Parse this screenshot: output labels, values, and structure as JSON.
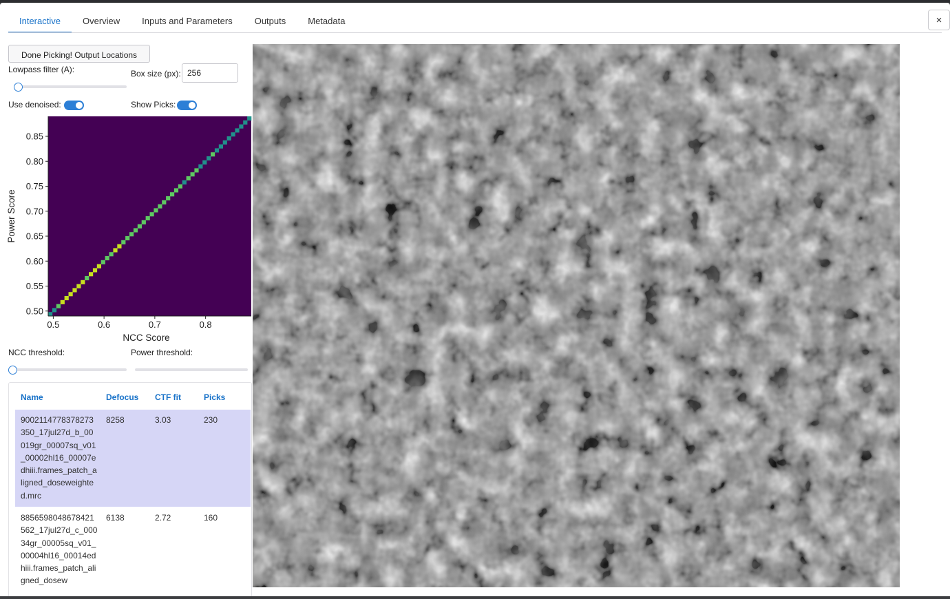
{
  "tabs": [
    {
      "label": "Interactive",
      "active": true
    },
    {
      "label": "Overview",
      "active": false
    },
    {
      "label": "Inputs and Parameters",
      "active": false
    },
    {
      "label": "Outputs",
      "active": false
    },
    {
      "label": "Metadata",
      "active": false
    }
  ],
  "close_label": "×",
  "controls": {
    "done_button": "Done Picking! Output Locations",
    "lowpass_label": "Lowpass filter (A):",
    "lowpass_value": 0,
    "box_size_label": "Box size (px):",
    "box_size_value": "256",
    "use_denoised_label": "Use denoised:",
    "use_denoised_on": true,
    "show_picks_label": "Show Picks:",
    "show_picks_on": true,
    "ncc_threshold_label": "NCC threshold:",
    "ncc_threshold_value": 0,
    "power_threshold_label": "Power threshold:"
  },
  "chart_data": {
    "type": "heatmap",
    "xlabel": "NCC Score",
    "ylabel": "Power Score",
    "xlim": [
      0.49,
      0.89
    ],
    "ylim": [
      0.49,
      0.89
    ],
    "xticks": [
      0.5,
      0.6,
      0.7,
      0.8
    ],
    "yticks": [
      0.5,
      0.55,
      0.6,
      0.65,
      0.7,
      0.75,
      0.8,
      0.85
    ],
    "xtick_labels": [
      "0.5",
      "0.6",
      "0.7",
      "0.8"
    ],
    "ytick_labels": [
      "0.50",
      "0.55",
      "0.60",
      "0.65",
      "0.70",
      "0.75",
      "0.80",
      "0.85"
    ],
    "bins": 50,
    "background_color": "#440154",
    "colors": {
      "low": "#21918c",
      "mid": "#5ec962",
      "high": "#c8e020"
    },
    "diagonal_intensity": [
      0.3,
      0.5,
      0.7,
      0.85,
      1.0,
      0.9,
      1.0,
      0.95,
      0.85,
      0.8,
      0.9,
      1.0,
      0.85,
      0.7,
      0.75,
      0.8,
      0.9,
      0.85,
      0.7,
      0.8,
      0.75,
      0.7,
      0.65,
      0.8,
      0.7,
      0.75,
      0.8,
      0.65,
      0.6,
      0.7,
      0.75,
      0.8,
      0.65,
      0.55,
      0.6,
      0.7,
      0.6,
      0.5,
      0.55,
      0.5,
      0.6,
      0.45,
      0.5,
      0.4,
      0.45,
      0.35,
      0.3,
      0.25,
      0.2,
      0.15
    ]
  },
  "table": {
    "columns": [
      "Name",
      "Defocus",
      "CTF fit",
      "Picks"
    ],
    "rows": [
      {
        "name": "9002114778378273350_17jul27d_b_00019gr_00007sq_v01_00002hl16_00007edhiii.frames_patch_aligned_doseweighted.mrc",
        "defocus": "8258",
        "ctf_fit": "3.03",
        "picks": "230",
        "selected": true
      },
      {
        "name": "8856598048678421562_17jul27d_c_00034gr_00005sq_v01_00004hl16_00014edhiii.frames_patch_aligned_dosew",
        "defocus": "6138",
        "ctf_fit": "2.72",
        "picks": "160",
        "selected": false
      }
    ]
  },
  "micrograph": {
    "alt": "grayscale micrograph"
  }
}
